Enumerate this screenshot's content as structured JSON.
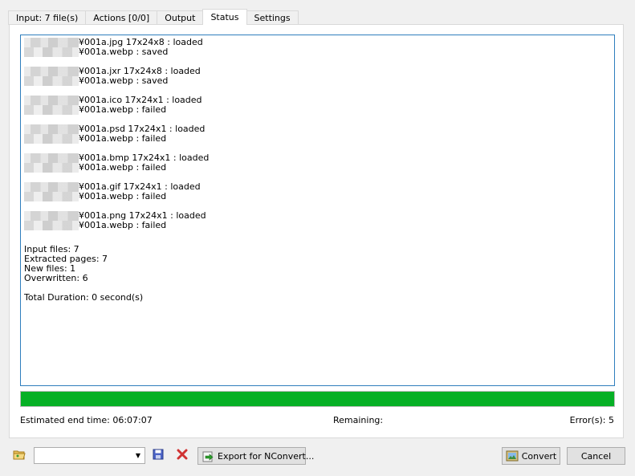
{
  "tabs": [
    {
      "label": "Input: 7 file(s)"
    },
    {
      "label": "Actions [0/0]"
    },
    {
      "label": "Output"
    },
    {
      "label": "Status"
    },
    {
      "label": "Settings"
    }
  ],
  "active_tab": "Status",
  "log": [
    {
      "line1": "¥001a.jpg  17x24x8 : loaded",
      "line2": "¥001a.webp : saved"
    },
    {
      "line1": "¥001a.jxr  17x24x8 : loaded",
      "line2": "¥001a.webp : saved"
    },
    {
      "line1": "¥001a.ico  17x24x1 : loaded",
      "line2": "¥001a.webp : failed"
    },
    {
      "line1": "¥001a.psd  17x24x1 : loaded",
      "line2": "¥001a.webp : failed"
    },
    {
      "line1": "¥001a.bmp  17x24x1 : loaded",
      "line2": "¥001a.webp : failed"
    },
    {
      "line1": "¥001a.gif  17x24x1 : loaded",
      "line2": "¥001a.webp : failed"
    },
    {
      "line1": "¥001a.png  17x24x1 : loaded",
      "line2": "¥001a.webp : failed"
    }
  ],
  "summary": {
    "input_files": "Input files: 7",
    "extracted_pages": "Extracted pages: 7",
    "new_files": "New files: 1",
    "overwritten": "Overwritten: 6",
    "total_duration": "Total Duration: 0 second(s)"
  },
  "progress_percent": 100,
  "status": {
    "estimated_end": "Estimated end time:  06:07:07",
    "remaining": "Remaining:",
    "errors": "Error(s):  5"
  },
  "bottom": {
    "export_label": "Export for NConvert...",
    "convert_label": "Convert",
    "cancel_label": "Cancel"
  },
  "colors": {
    "progress": "#06b025",
    "log_border": "#2f7ebd"
  },
  "icons": [
    "folder-open-icon",
    "save-icon",
    "delete-icon",
    "export-icon",
    "convert-icon",
    "chevron-down-icon"
  ]
}
